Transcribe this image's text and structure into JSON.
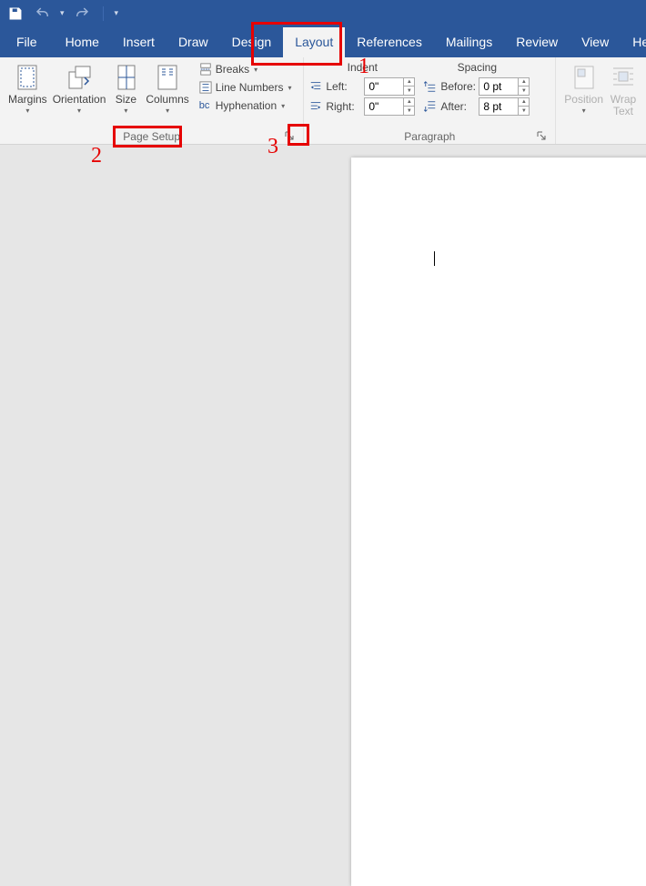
{
  "qat": {
    "customize_tip": "Customize Quick Access Toolbar"
  },
  "tabs": {
    "file": "File",
    "home": "Home",
    "insert": "Insert",
    "draw": "Draw",
    "design": "Design",
    "layout": "Layout",
    "references": "References",
    "mailings": "Mailings",
    "review": "Review",
    "view": "View",
    "help": "Help"
  },
  "ribbon": {
    "page_setup": {
      "title": "Page Setup",
      "margins": "Margins",
      "orientation": "Orientation",
      "size": "Size",
      "columns": "Columns",
      "breaks": "Breaks",
      "line_numbers": "Line Numbers",
      "hyphenation": "Hyphenation"
    },
    "paragraph": {
      "title": "Paragraph",
      "indent_head": "Indent",
      "spacing_head": "Spacing",
      "left_label": "Left:",
      "right_label": "Right:",
      "before_label": "Before:",
      "after_label": "After:",
      "left_value": "0\"",
      "right_value": "0\"",
      "before_value": "0 pt",
      "after_value": "8 pt"
    },
    "arrange": {
      "position": "Position",
      "wrap_text": "Wrap\nText"
    }
  },
  "annotations": {
    "one": "1",
    "two": "2",
    "three": "3"
  }
}
